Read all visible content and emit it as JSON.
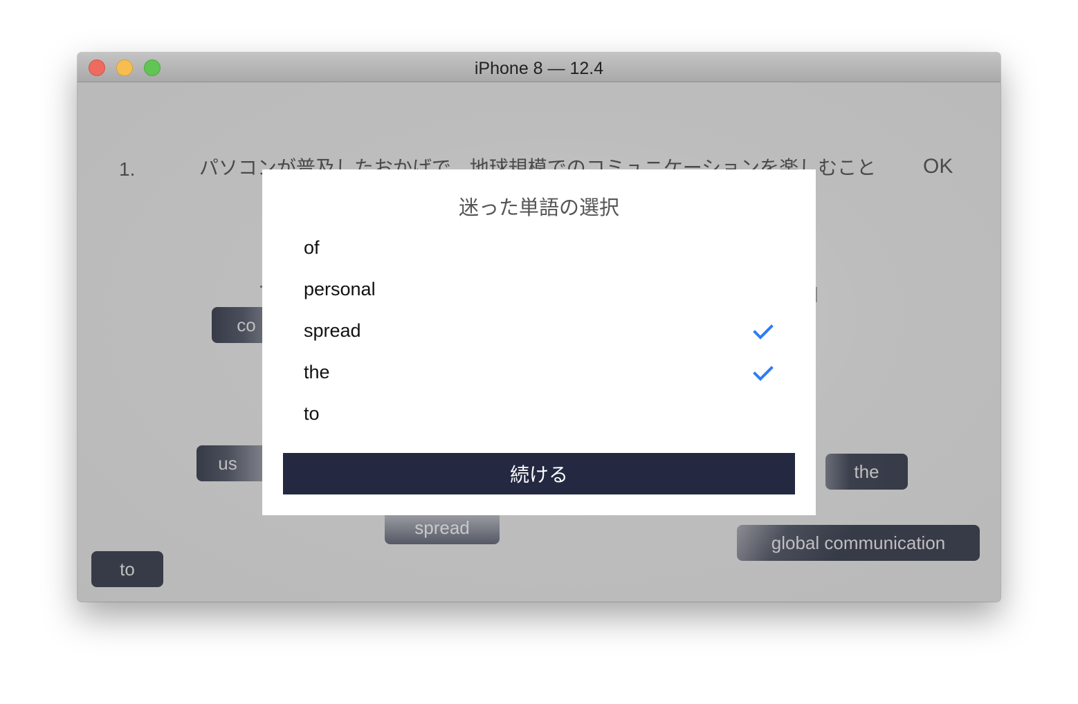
{
  "window": {
    "title": "iPhone 8 — 12.4",
    "controls": [
      "close",
      "minimize",
      "maximize"
    ]
  },
  "question": {
    "number": "1.",
    "text": "パソコンが普及したおかげで、地球規模でのコミュニケーションを楽しむことができる。",
    "ok_label": "OK"
  },
  "word_chips": [
    {
      "label": "co",
      "state": "partially-hidden"
    },
    {
      "label": "us",
      "state": "normal"
    },
    {
      "label": "the",
      "state": "normal"
    },
    {
      "label": "spread",
      "state": "used"
    },
    {
      "label": "global communication",
      "state": "normal"
    },
    {
      "label": "to",
      "state": "normal"
    }
  ],
  "modal": {
    "title": "迷った単語の選択",
    "words": [
      {
        "label": "of",
        "checked": false
      },
      {
        "label": "personal",
        "checked": false
      },
      {
        "label": "spread",
        "checked": true
      },
      {
        "label": "the",
        "checked": true
      },
      {
        "label": "to",
        "checked": false
      }
    ],
    "continue_label": "続ける",
    "check_icon": "checkmark-icon",
    "colors": {
      "check": "#2f7bf5",
      "button": "#242941"
    }
  }
}
